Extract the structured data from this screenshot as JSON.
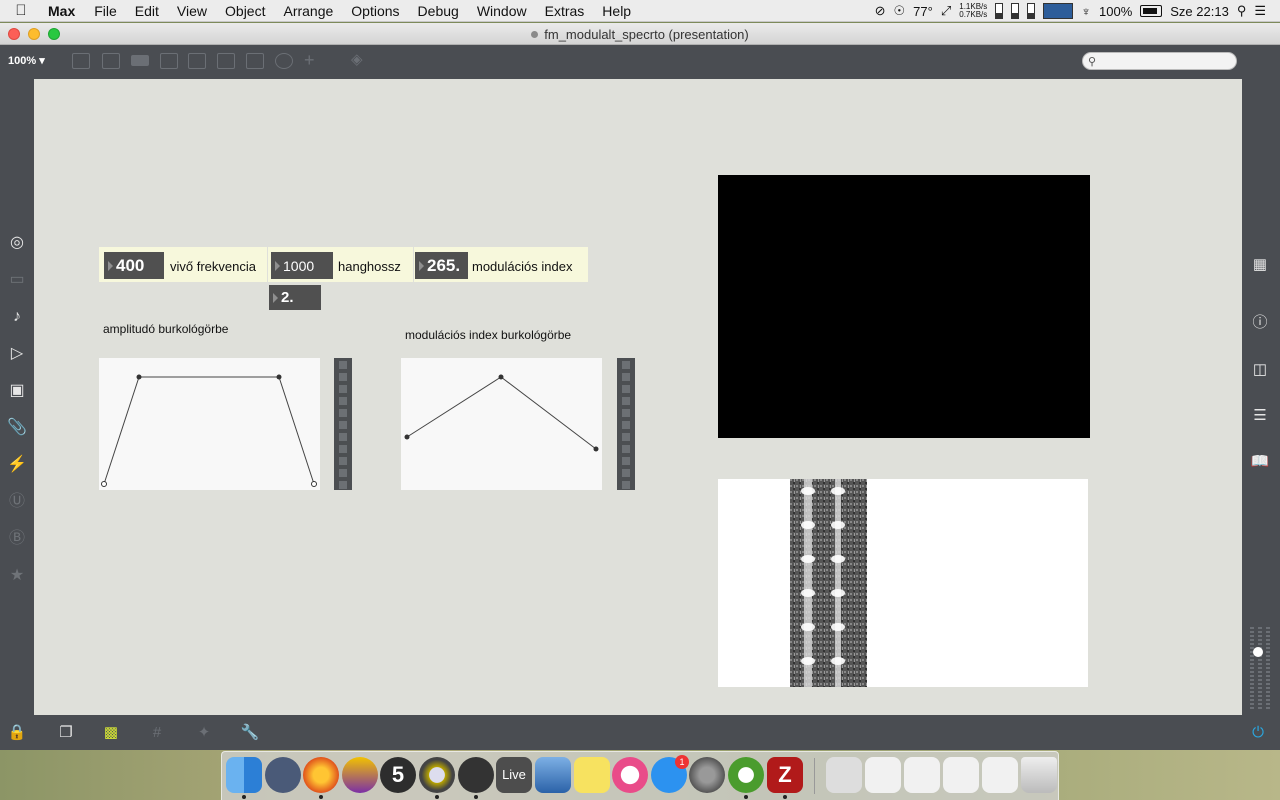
{
  "menubar": {
    "app": "Max",
    "menus": [
      "File",
      "Edit",
      "View",
      "Object",
      "Arrange",
      "Options",
      "Debug",
      "Window",
      "Extras",
      "Help"
    ],
    "status": {
      "temp": "77°",
      "net_up": "1.1KB/s",
      "net_down": "0.7KB/s",
      "battery": "100%",
      "clock": "Sze 22:13"
    }
  },
  "window": {
    "title": "fm_modulalt_specrto (presentation)",
    "zoom": "100%"
  },
  "patch": {
    "carrier": {
      "value": "400",
      "label": "vivő frekvencia"
    },
    "duration": {
      "value": "1000",
      "label": "hanghossz"
    },
    "modindex": {
      "value": "265.",
      "label": "modulációs index"
    },
    "extra": {
      "value": "2."
    },
    "amp_env_label": "amplitudó burkológörbe",
    "mod_env_label": "modulációs index burkológörbe"
  },
  "dock": {
    "live_label": "Live",
    "badge": "1",
    "five": "5"
  },
  "colors": {
    "canvas": "#dfe0da",
    "numbox": "#505050",
    "comment": "#f7f8dc",
    "chrome": "#4a4d52"
  }
}
